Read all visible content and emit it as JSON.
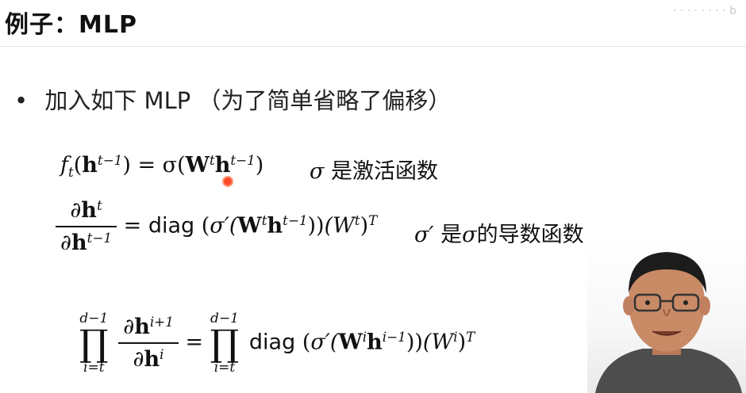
{
  "slide": {
    "title": "例子：MLP",
    "watermark": "· · · · · · · · b",
    "bullet": "加入如下 MLP （为了简单省略了偏移）"
  },
  "equations": {
    "eq1": {
      "lhs_f": "f",
      "lhs_sub": "t",
      "lhs_open": "(",
      "h": "h",
      "sup": "t−1",
      "equals": ") = σ(",
      "W": "W",
      "Wsup": "t",
      "h2": "h",
      "h2sup": "t−1",
      "close": ")",
      "note_sigma": "σ",
      "note_text": "是激活函数"
    },
    "eq2": {
      "num_partial": "∂",
      "num_h": "h",
      "num_sup": "t",
      "den_partial": "∂",
      "den_h": "h",
      "den_sup": "t−1",
      "equals": "=",
      "diag": "diag",
      "open": "(",
      "sigma_prime": "σ′(",
      "W": "W",
      "Wsup": "t",
      "h": "h",
      "hsup": "t−1",
      "inner_close": "))",
      "W2": "(W",
      "W2sup": "t",
      "W2close": ")",
      "T": "T",
      "note_sigma": "σ′",
      "note_text1": "是",
      "note_sigma2": "σ",
      "note_text2": "的导数函数"
    },
    "eq3": {
      "prod_upper": "d−1",
      "prod_symbol": "∏",
      "prod_lower": "i=t",
      "num_partial": "∂",
      "num_h": "h",
      "num_sup": "i+1",
      "den_partial": "∂",
      "den_h": "h",
      "den_sup": "i",
      "equals": "=",
      "prod2_upper": "d−1",
      "prod2_symbol": "∏",
      "prod2_lower": "i=t",
      "diag": "diag",
      "open": "(",
      "sigma_prime": "σ′(",
      "W": "W",
      "Wsup": "i",
      "h": "h",
      "hsup": "i−1",
      "inner_close": "))",
      "W2": "(W",
      "W2sup": "i",
      "W2close": ")",
      "T": "T"
    }
  },
  "colors": {
    "cursor": "#ff4a2b",
    "skin": "#c98a66",
    "hair": "#1c1c1c",
    "shirt": "#4d4d4d"
  }
}
